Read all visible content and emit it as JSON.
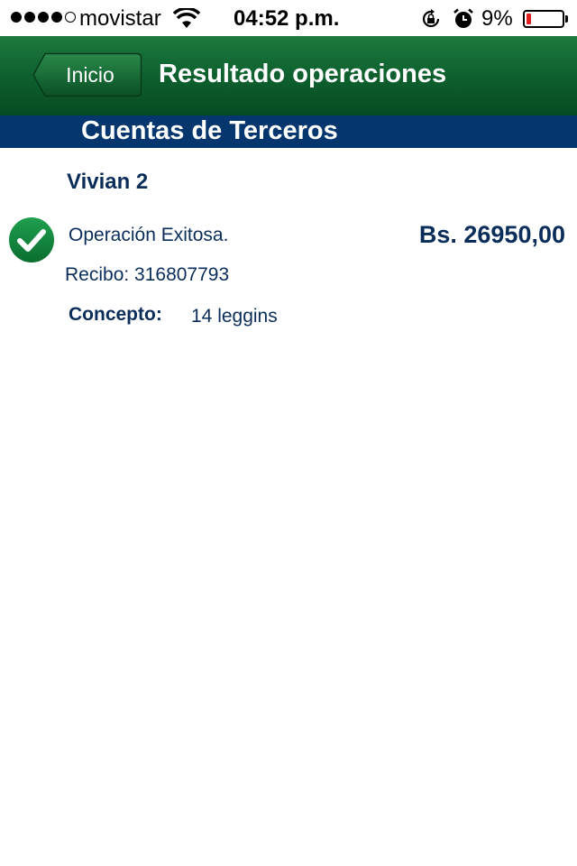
{
  "status_bar": {
    "carrier": "movistar",
    "time": "04:52 p.m.",
    "battery_percent": "9%",
    "battery_level": 0.09,
    "signal_bars": 4,
    "signal_total": 5
  },
  "nav": {
    "back_label": "Inicio",
    "title": "Resultado operaciones"
  },
  "section": {
    "title": "Cuentas de Terceros"
  },
  "result": {
    "beneficiary": "Vivian 2",
    "status": "Operación Exitosa.",
    "amount": "Bs. 26950,00",
    "receipt": "Recibo: 316807793",
    "concept_label": "Concepto:",
    "concept_value": "14 leggins"
  },
  "colors": {
    "nav_green": "#0f6330",
    "section_blue": "#05376e",
    "text_navy": "#0a2d5a",
    "success_green": "#13873f",
    "battery_red": "#e02020"
  },
  "icons": {
    "status_wifi": "wifi-icon",
    "status_rotation": "rotation-lock-icon",
    "status_alarm": "alarm-icon",
    "status_battery": "battery-icon",
    "result_icon": "checkmark-icon"
  }
}
